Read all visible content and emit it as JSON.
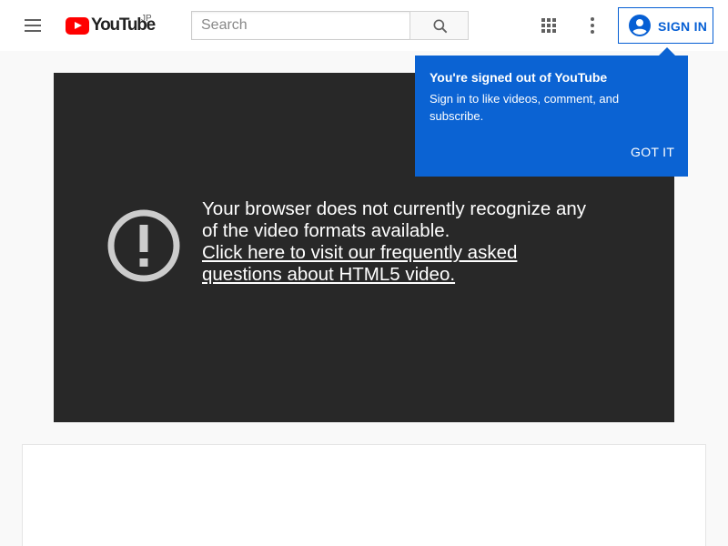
{
  "header": {
    "logo_text": "YouTube",
    "region": "JP",
    "search_placeholder": "Search",
    "signin_label": "SIGN IN"
  },
  "icons": {
    "menu": "menu-icon",
    "search": "search-icon",
    "apps": "apps-icon",
    "more": "more-vert-icon",
    "account": "account-circle-icon",
    "error": "alert-icon"
  },
  "player": {
    "error_line1": "Your browser does not currently recognize any",
    "error_line2": "of the video formats available.",
    "link_line1": "Click here to visit our frequently asked",
    "link_line2": "questions about HTML5 video."
  },
  "tooltip": {
    "title": "You're signed out of YouTube",
    "body": "Sign in to like videos, comment, and subscribe.",
    "button": "GOT IT"
  },
  "colors": {
    "brand": "#ff0000",
    "accent": "#065fd4",
    "tooltip_bg": "#0b63d3",
    "player_bg": "#282828"
  }
}
